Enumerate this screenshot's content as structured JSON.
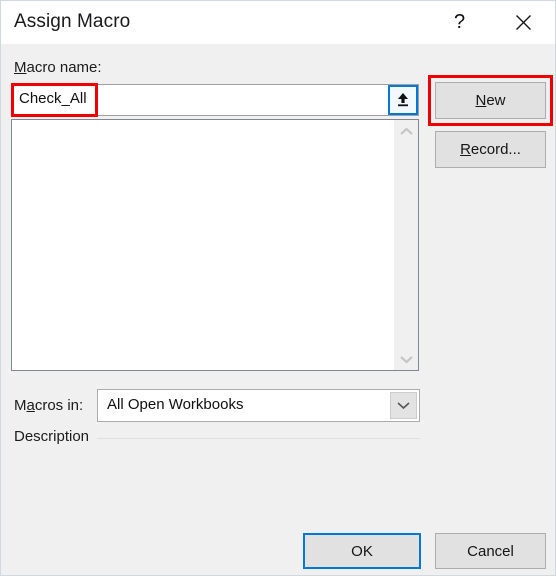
{
  "dialog": {
    "title": "Assign Macro",
    "help_icon": "question-mark-icon",
    "close_icon": "close-icon",
    "accent_color": "#0078d7",
    "annotation_color": "#ee0000",
    "body_color": "#f0f0f0"
  },
  "macro_name": {
    "label_prefix": "M",
    "label_rest": "acro name:",
    "value": "Check_All",
    "placeholder": "",
    "promote_icon": "upload-arrow-icon"
  },
  "macro_list": {
    "items": [],
    "scroll_up_icon": "chevron-up-icon",
    "scroll_down_icon": "chevron-down-icon"
  },
  "macros_in": {
    "label_prefix": "M",
    "label_mid": "a",
    "label_rest": "cros in:",
    "selected": "All Open Workbooks",
    "options": [
      "All Open Workbooks"
    ],
    "dropdown_icon": "chevron-down-icon"
  },
  "description": {
    "label": "Description",
    "text": ""
  },
  "buttons": {
    "new_prefix": "N",
    "new_rest": "ew",
    "record_prefix": "R",
    "record_rest": "ecord...",
    "ok": "OK",
    "cancel": "Cancel"
  }
}
